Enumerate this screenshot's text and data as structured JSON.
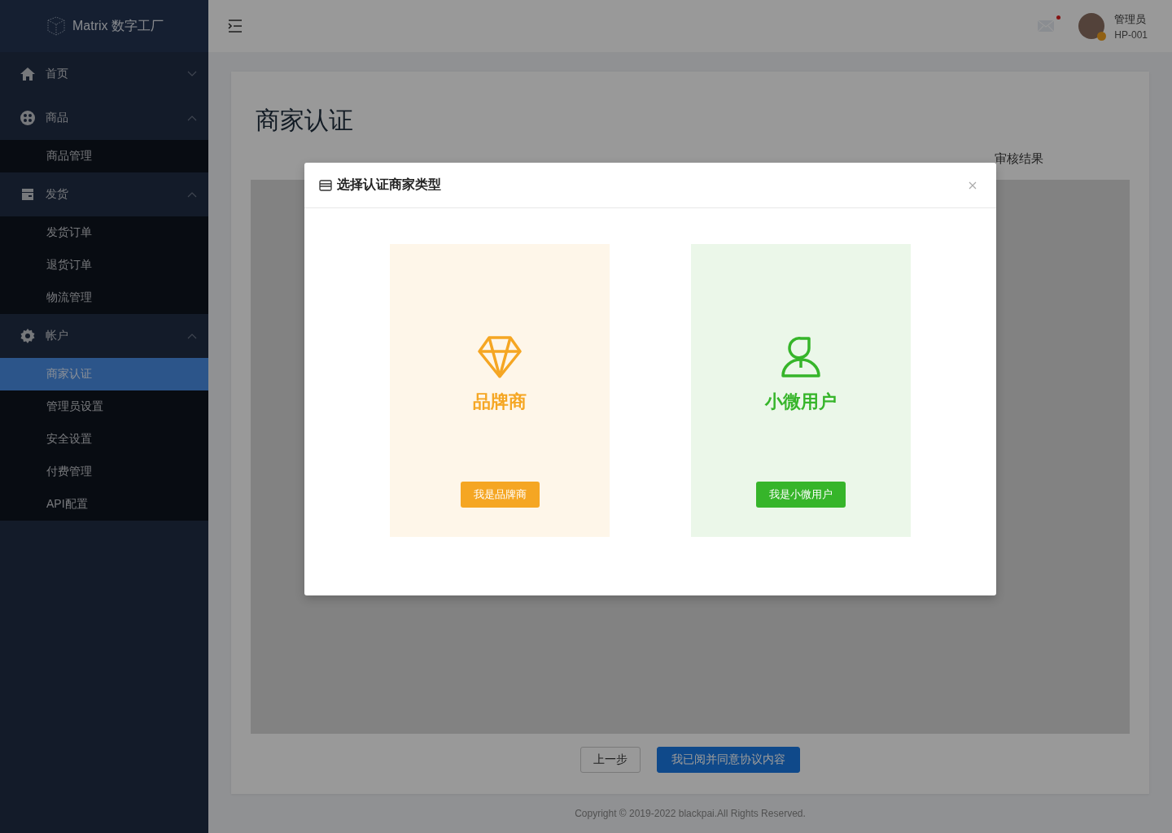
{
  "sidebar": {
    "logo": "Matrix 数字工厂",
    "menu": [
      {
        "kind": "home",
        "label": "首页",
        "expanded": false
      },
      {
        "kind": "goods",
        "label": "商品",
        "expanded": true,
        "children": [
          {
            "label": "商品管理",
            "selected": false
          }
        ]
      },
      {
        "kind": "box",
        "label": "发货",
        "expanded": true,
        "children": [
          {
            "label": "发货订单",
            "selected": false
          },
          {
            "label": "退货订单",
            "selected": false
          },
          {
            "label": "物流管理",
            "selected": false
          }
        ]
      },
      {
        "kind": "gear",
        "label": "帐户",
        "expanded": true,
        "children": [
          {
            "label": "商家认证",
            "selected": true
          },
          {
            "label": "管理员设置",
            "selected": false
          },
          {
            "label": "安全设置",
            "selected": false
          },
          {
            "label": "付费管理",
            "selected": false
          },
          {
            "label": "API配置",
            "selected": false
          }
        ]
      }
    ]
  },
  "header": {
    "user_name": "管理员",
    "user_id": "HP-001"
  },
  "page": {
    "title": "商家认证",
    "step_label": "审核结果",
    "buttons": [
      {
        "kind": "default",
        "label": "上一步"
      },
      {
        "kind": "primary",
        "label": "我已阅并同意协议内容"
      }
    ]
  },
  "footer": "Copyright © 2019-2022 blackpai.All Rights Reserved.",
  "modal": {
    "title": "选择认证商家类型",
    "options": [
      {
        "kind": "brand",
        "title": "品牌商",
        "button": "我是品牌商",
        "color": "#f5a623"
      },
      {
        "kind": "user",
        "title": "小微用户",
        "button": "我是小微用户",
        "color": "#36b52a"
      }
    ]
  }
}
